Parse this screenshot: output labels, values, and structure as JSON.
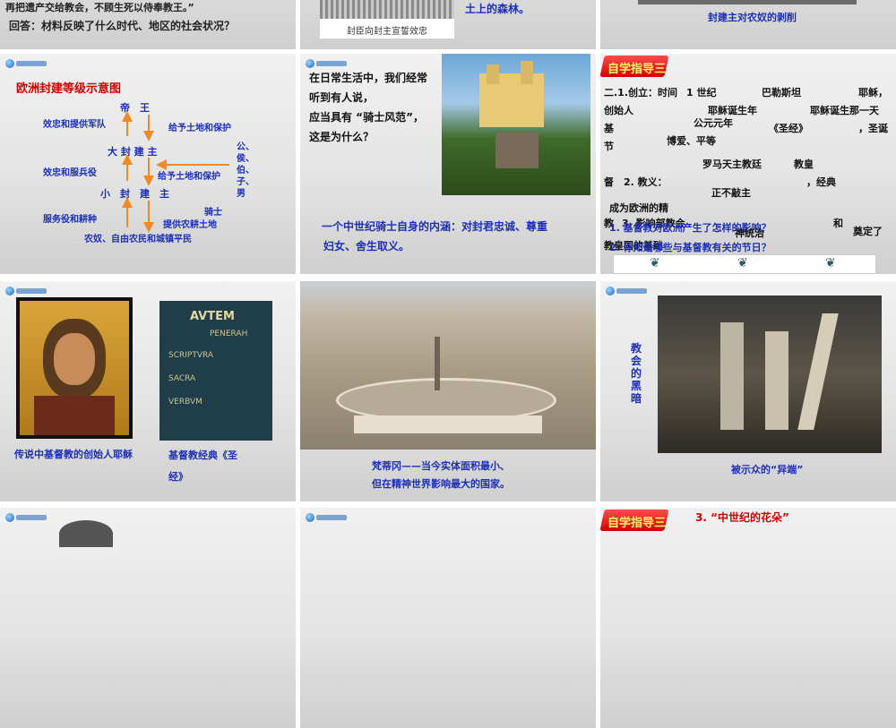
{
  "s1": {
    "top_text": "再把遗产交给教会，不顾生死以侍奉教王。”",
    "question": "回答：材料反映了什么时代、地区的社会状况？"
  },
  "s2": {
    "caption": "封臣向封主宣誓效忠",
    "text": "土上的森林。"
  },
  "s3": {
    "caption": "封建主对农奴的剥削"
  },
  "s4": {
    "title": "欧洲封建等级示意图",
    "king": "帝　王",
    "big_lord": "大 封 建 主",
    "small_lord": "小　封　建　主",
    "loyalty1": "效忠和提供军队",
    "protect1": "给予土地和保护",
    "loyalty2": "效忠和服兵役",
    "protect2": "给予土地和保护",
    "service": "服务役和耕种",
    "land": "提供农耕土地",
    "ranks": [
      "公、",
      "侯、",
      "伯、",
      "子、",
      "男"
    ],
    "knight": "骑士",
    "peasants": "农奴、自由农民和城镇平民"
  },
  "s5": {
    "q1": "在日常生活中，我们经常",
    "q2": "听到有人说，",
    "q3": "应当具有 “骑士风范”，",
    "q4": "这是为什么？",
    "a1": "一个中世纪骑士自身的内涵：对封君忠诚、尊重",
    "a2": "妇女、舍生取义。"
  },
  "s6": {
    "tag": "自学指导三",
    "l1a": "二.1.创立：时间",
    "l1b": "1 世纪",
    "l1c": "巴勒斯坦",
    "l1d": "耶稣，",
    "l2a": "创始人",
    "l2b": "耶稣诞生年",
    "l2c": "耶稣诞生那一天",
    "l3a": "基",
    "l3b": "公元元年",
    "l3c": "《圣经》",
    "l3d": "，圣诞",
    "l4a": "节",
    "l4b": "博爱、平等",
    "l5a": "罗马天主教廷",
    "l5b": "教皇",
    "l6a": "督　2. 教义：",
    "l6b": "，经典",
    "l7a": "教",
    "l7b": "3. 影响部教会",
    "l7c": "和",
    "l8a": "成为欧洲的精",
    "l8b": "神统治",
    "l8c": "奠定了",
    "l9a": "教皇国的基础",
    "q1": "1. 基督教对欧洲产生了怎样的影响？",
    "q2": "2. 你知道哪些与基督教有关的节日？",
    "extra1": "正不敲主"
  },
  "s7": {
    "cap1": "传说中基督教的创始人耶稣",
    "cap2a": "基督教经典《圣",
    "cap2b": "经》",
    "book_lines": [
      "AVTEM",
      "PENERAH",
      "SCRIPTVRA",
      "SACRA",
      "VERBVM"
    ]
  },
  "s8": {
    "cap1": "梵蒂冈——当今实体面积最小、",
    "cap2": "但在精神世界影响最大的国家。"
  },
  "s9": {
    "side": [
      "教",
      "会",
      "的",
      "黑",
      "暗"
    ],
    "cap": "被示众的“异端”"
  },
  "s12": {
    "tag": "自学指导三",
    "text": "3. “中世纪的花朵”"
  }
}
